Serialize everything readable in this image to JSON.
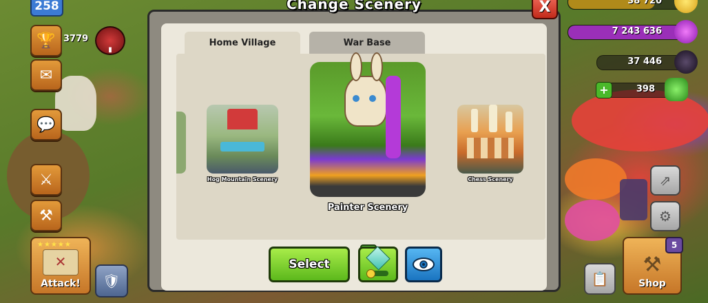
{
  "dialog": {
    "title": "Change Scenery",
    "close_label": "X"
  },
  "tabs": [
    {
      "label": "Home Village",
      "active": true
    },
    {
      "label": "War Base",
      "active": false
    }
  ],
  "sceneries": [
    {
      "name": "Hog Mountain Scenery",
      "selected": false
    },
    {
      "name": "Painter Scenery",
      "selected": true
    },
    {
      "name": "Chess Scenery",
      "selected": false
    }
  ],
  "actions": {
    "select_label": "Select"
  },
  "hud": {
    "level": "258",
    "trophies": "3779",
    "attack_label": "Attack!",
    "shop_label": "Shop",
    "shop_badge": "5"
  },
  "resources": [
    {
      "name": "gold",
      "value": "38 720",
      "color": "#f2c230"
    },
    {
      "name": "elixir",
      "value": "7 243 636",
      "color": "#c838e0"
    },
    {
      "name": "dark-elixir",
      "value": "37 446",
      "color": "#2a2030"
    },
    {
      "name": "gems",
      "value": "398",
      "color": "#3aa83a"
    }
  ],
  "icons": [
    "trophy-icon",
    "mail-icon",
    "chat-icon",
    "swords-icon",
    "builder-icon",
    "map-icon",
    "shield-icon",
    "checkmark-icon",
    "gem-cube-icon",
    "eye-icon",
    "settings-gear-icon",
    "layout-edit-icon",
    "clipboard-icon",
    "hammer-icon",
    "plus-icon"
  ]
}
